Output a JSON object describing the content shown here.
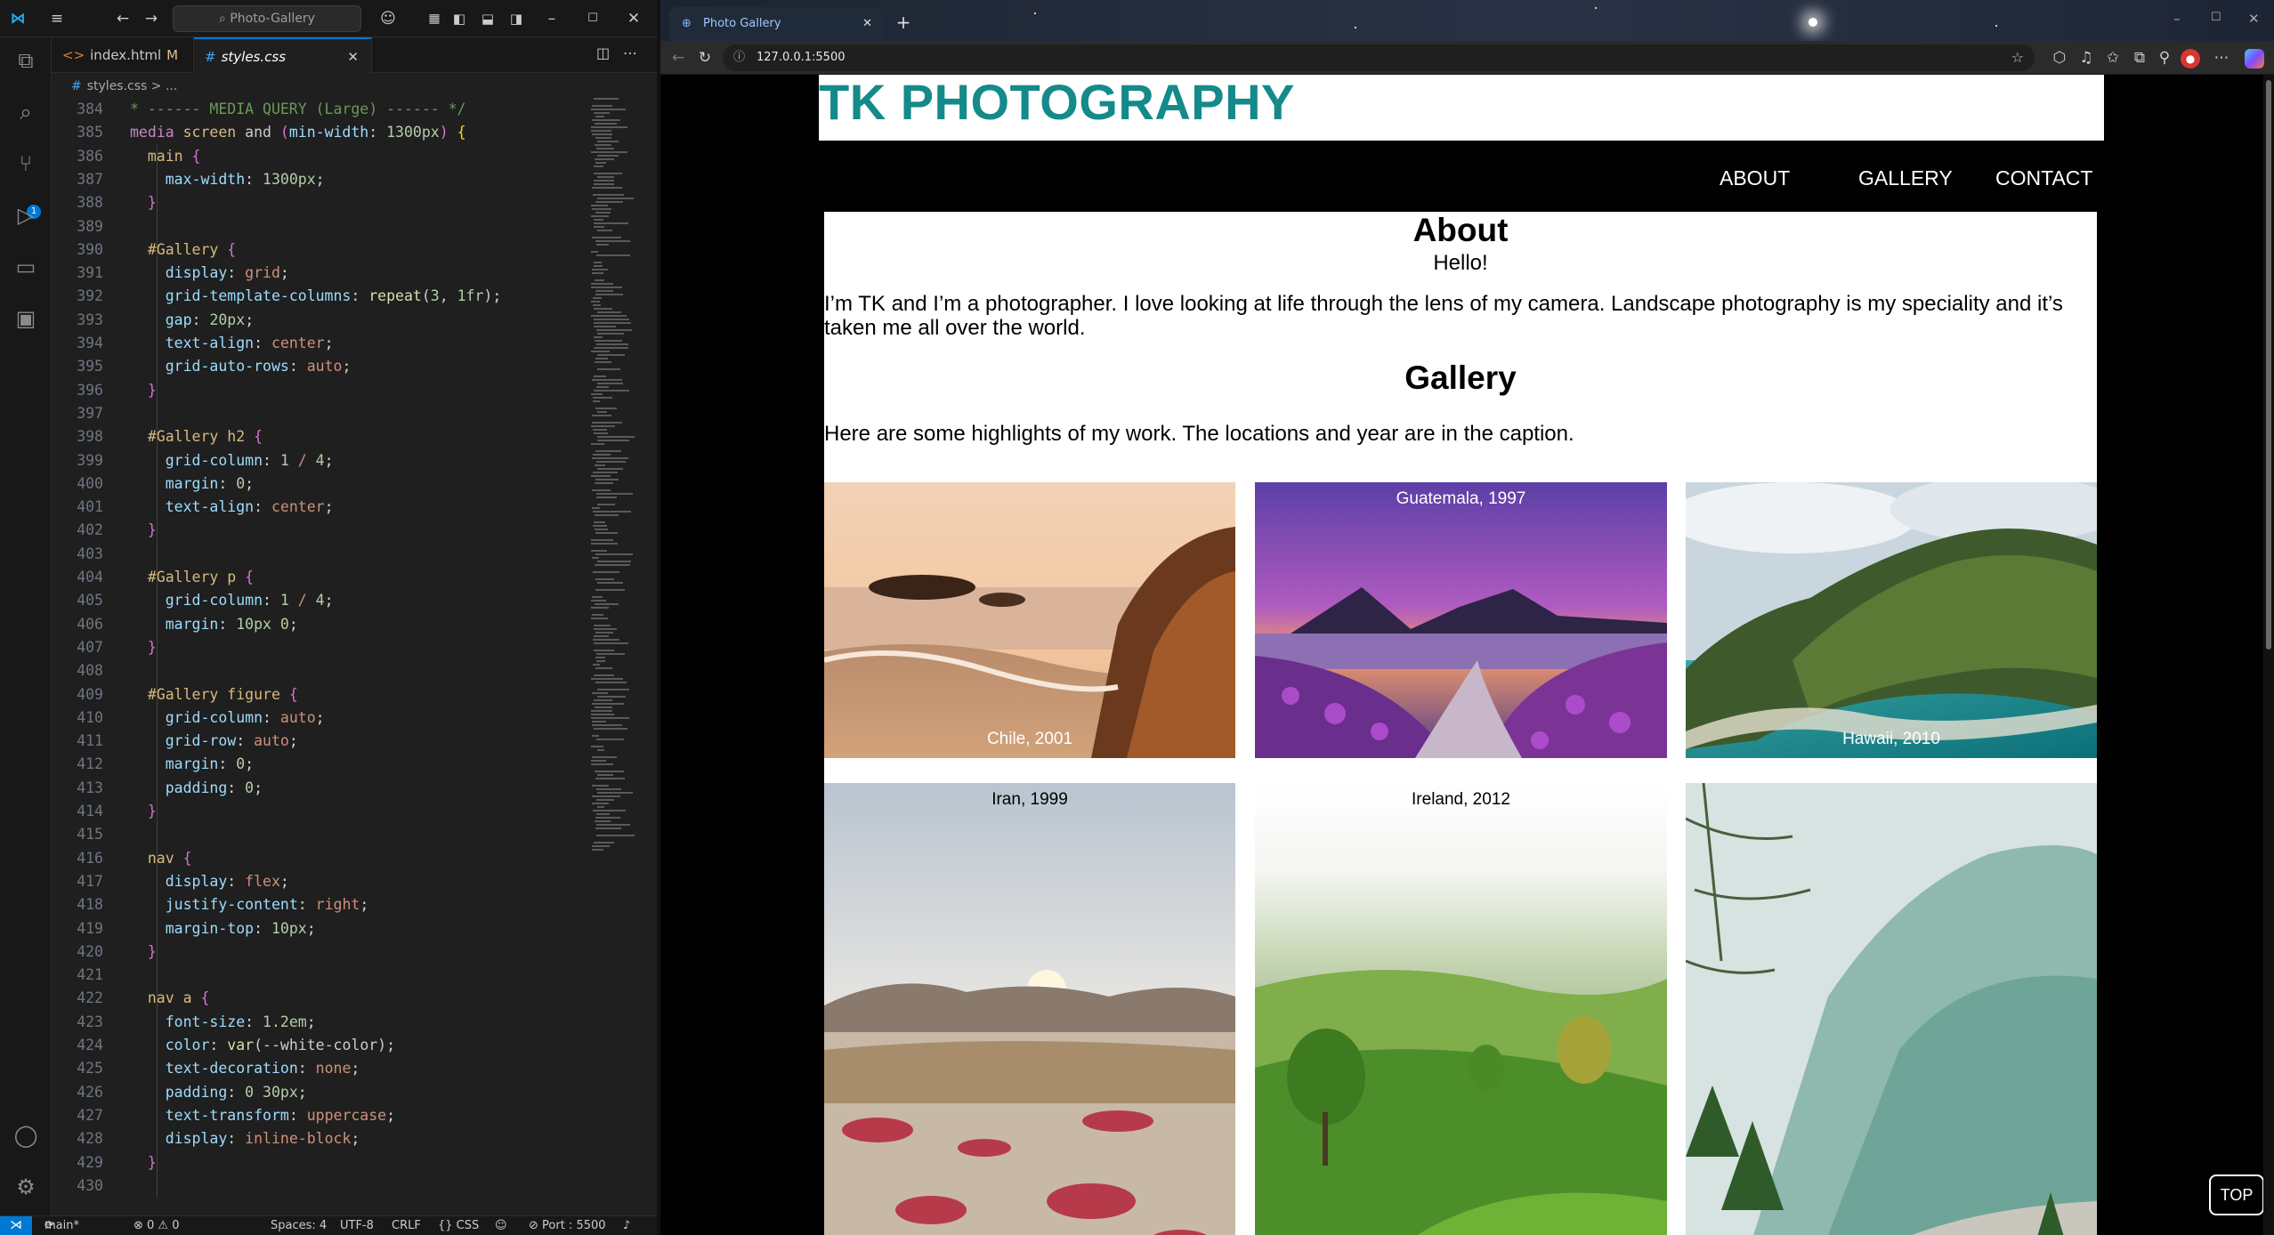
{
  "vscode": {
    "search": "Photo-Gallery",
    "tabs": [
      {
        "label": "index.html",
        "badge": "M"
      },
      {
        "label": "styles.css"
      }
    ],
    "breadcrumb": "styles.css > ...",
    "scm_badge": "1",
    "code_lines": [
      {
        "n": "384",
        "t": "* ------ MEDIA QUERY (Large) ------ */"
      },
      {
        "n": "385",
        "t": "media screen and (min-width: 1300px) {"
      },
      {
        "n": "386",
        "t": "  main {"
      },
      {
        "n": "387",
        "t": "    max-width: 1300px;"
      },
      {
        "n": "388",
        "t": "  }"
      },
      {
        "n": "389",
        "t": ""
      },
      {
        "n": "390",
        "t": "  #Gallery {"
      },
      {
        "n": "391",
        "t": "    display: grid;"
      },
      {
        "n": "392",
        "t": "    grid-template-columns: repeat(3, 1fr);"
      },
      {
        "n": "393",
        "t": "    gap: 20px;"
      },
      {
        "n": "394",
        "t": "    text-align: center;"
      },
      {
        "n": "395",
        "t": "    grid-auto-rows: auto;"
      },
      {
        "n": "396",
        "t": "  }"
      },
      {
        "n": "397",
        "t": ""
      },
      {
        "n": "398",
        "t": "  #Gallery h2 {"
      },
      {
        "n": "399",
        "t": "    grid-column: 1 / 4;"
      },
      {
        "n": "400",
        "t": "    margin: 0;"
      },
      {
        "n": "401",
        "t": "    text-align: center;"
      },
      {
        "n": "402",
        "t": "  }"
      },
      {
        "n": "403",
        "t": ""
      },
      {
        "n": "404",
        "t": "  #Gallery p {"
      },
      {
        "n": "405",
        "t": "    grid-column: 1 / 4;"
      },
      {
        "n": "406",
        "t": "    margin: 10px 0;"
      },
      {
        "n": "407",
        "t": "  }"
      },
      {
        "n": "408",
        "t": ""
      },
      {
        "n": "409",
        "t": "  #Gallery figure {"
      },
      {
        "n": "410",
        "t": "    grid-column: auto;"
      },
      {
        "n": "411",
        "t": "    grid-row: auto;"
      },
      {
        "n": "412",
        "t": "    margin: 0;"
      },
      {
        "n": "413",
        "t": "    padding: 0;"
      },
      {
        "n": "414",
        "t": "  }"
      },
      {
        "n": "415",
        "t": ""
      },
      {
        "n": "416",
        "t": "  nav {"
      },
      {
        "n": "417",
        "t": "    display: flex;"
      },
      {
        "n": "418",
        "t": "    justify-content: right;"
      },
      {
        "n": "419",
        "t": "    margin-top: 10px;"
      },
      {
        "n": "420",
        "t": "  }"
      },
      {
        "n": "421",
        "t": ""
      },
      {
        "n": "422",
        "t": "  nav a {"
      },
      {
        "n": "423",
        "t": "    font-size: 1.2em;"
      },
      {
        "n": "424",
        "t": "    color: var(--white-color);"
      },
      {
        "n": "425",
        "t": "    text-decoration: none;"
      },
      {
        "n": "426",
        "t": "    padding: 0 30px;"
      },
      {
        "n": "427",
        "t": "    text-transform: uppercase;"
      },
      {
        "n": "428",
        "t": "    display: inline-block;"
      },
      {
        "n": "429",
        "t": "  }"
      },
      {
        "n": "430",
        "t": ""
      }
    ],
    "status": {
      "branch": "main*",
      "problems": "⊗ 0 ⚠ 0",
      "spaces": "Spaces: 4",
      "encoding": "UTF-8",
      "eol": "CRLF",
      "language": "{} CSS",
      "port": "⊘ Port : 5500"
    }
  },
  "browser": {
    "tab_title": "Photo Gallery",
    "url": "127.0.0.1:5500"
  },
  "site": {
    "title": "TK PHOTOGRAPHY",
    "nav": [
      "ABOUT",
      "GALLERY",
      "CONTACT"
    ],
    "about_heading": "About",
    "about_hello": "Hello!",
    "about_text": "I’m TK and I’m a photographer. I love looking at life through the lens of my camera. Landscape photography is my speciality and it’s taken me all over the world.",
    "gallery_heading": "Gallery",
    "gallery_text": "Here are some highlights of my work. The locations and year are in the caption.",
    "photos": [
      {
        "caption": "Chile, 2001",
        "caption_pos": "bottom",
        "caption_color": "#ffffff"
      },
      {
        "caption": "Guatemala, 1997",
        "caption_pos": "top",
        "caption_color": "#ffffff"
      },
      {
        "caption": "Hawaii, 2010",
        "caption_pos": "bottom",
        "caption_color": "#ffffff"
      },
      {
        "caption": "Iran, 1999",
        "caption_pos": "top",
        "caption_color": "#000000"
      },
      {
        "caption": "Ireland, 2012",
        "caption_pos": "top",
        "caption_color": "#000000"
      },
      {
        "caption": "",
        "caption_pos": "none",
        "caption_color": "#000000"
      }
    ],
    "top_button": "TOP"
  },
  "colors": {
    "brand_teal": "#148a8a",
    "vscode_accent": "#0078d4"
  }
}
